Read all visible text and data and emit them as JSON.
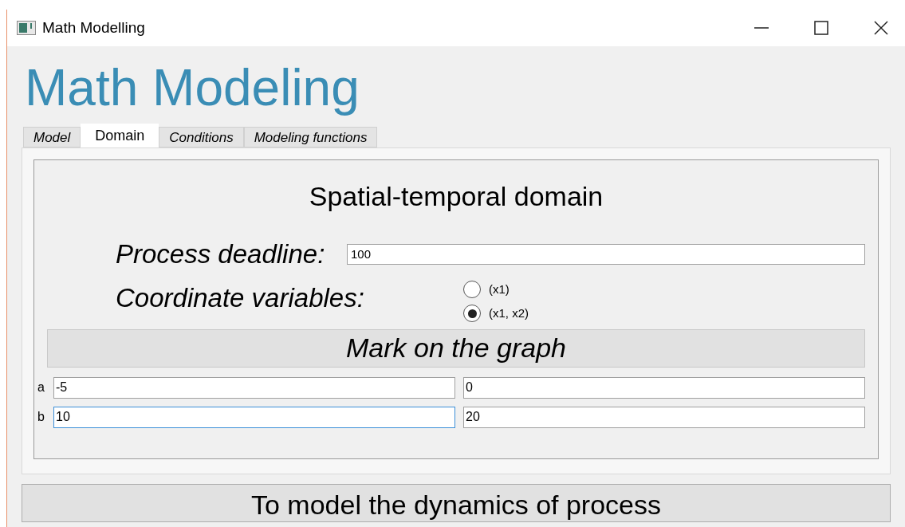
{
  "window": {
    "title": "Math Modelling"
  },
  "heading": "Math Modeling",
  "tabs": [
    {
      "label": "Model",
      "selected": false
    },
    {
      "label": "Domain",
      "selected": true
    },
    {
      "label": "Conditions",
      "selected": false
    },
    {
      "label": "Modeling functions",
      "selected": false
    }
  ],
  "domain": {
    "title": "Spatial-temporal domain",
    "deadline": {
      "label": "Process deadline:",
      "value": "100"
    },
    "coordinates": {
      "label": "Coordinate variables:",
      "options": [
        {
          "label": "(x1)",
          "selected": false
        },
        {
          "label": "(x1, x2)",
          "selected": true
        }
      ]
    },
    "mark_header": "Mark on the graph",
    "rows": [
      {
        "label": "a",
        "values": [
          {
            "value": "-5",
            "focused": false
          },
          {
            "value": "0",
            "focused": false
          }
        ]
      },
      {
        "label": "b",
        "values": [
          {
            "value": "10",
            "focused": true
          },
          {
            "value": "20",
            "focused": false
          }
        ]
      }
    ]
  },
  "action_button": "To model the dynamics of process"
}
